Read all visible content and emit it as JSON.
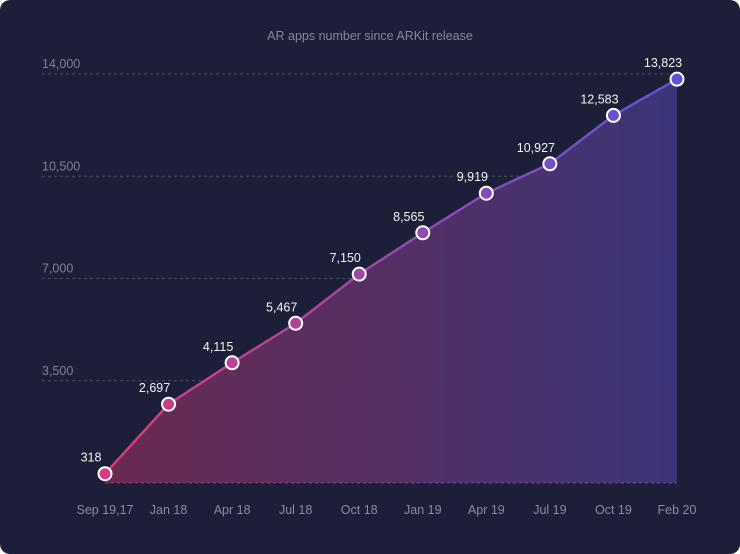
{
  "chart_data": {
    "type": "area",
    "title": "AR apps number since ARKit release",
    "xlabel": "",
    "ylabel": "",
    "categories": [
      "Sep 19,17",
      "Jan 18",
      "Apr 18",
      "Jul 18",
      "Oct 18",
      "Jan 19",
      "Apr 19",
      "Jul 19",
      "Oct 19",
      "Feb 20"
    ],
    "series": [
      {
        "name": "AR apps",
        "values": [
          318,
          2697,
          4115,
          5467,
          7150,
          8565,
          9919,
          10927,
          12583,
          13823
        ],
        "labels": [
          "318",
          "2,697",
          "4,115",
          "5,467",
          "7,150",
          "8,565",
          "9,919",
          "10,927",
          "12,583",
          "13,823"
        ]
      }
    ],
    "ylim": [
      0,
      14000
    ],
    "yticks": [
      3500,
      7000,
      10500,
      14000
    ],
    "ytick_labels": [
      "3,500",
      "7,000",
      "10,500",
      "14,000"
    ],
    "grid": true,
    "legend": "none",
    "colors": {
      "background": "#1d1e37",
      "gradient_start": "#d83c7e",
      "gradient_end": "#5b55d6",
      "fill_start": "#6a2a50",
      "fill_end": "#3c3478",
      "marker_stroke": "#ffffff",
      "grid": "#4a4b63"
    }
  }
}
